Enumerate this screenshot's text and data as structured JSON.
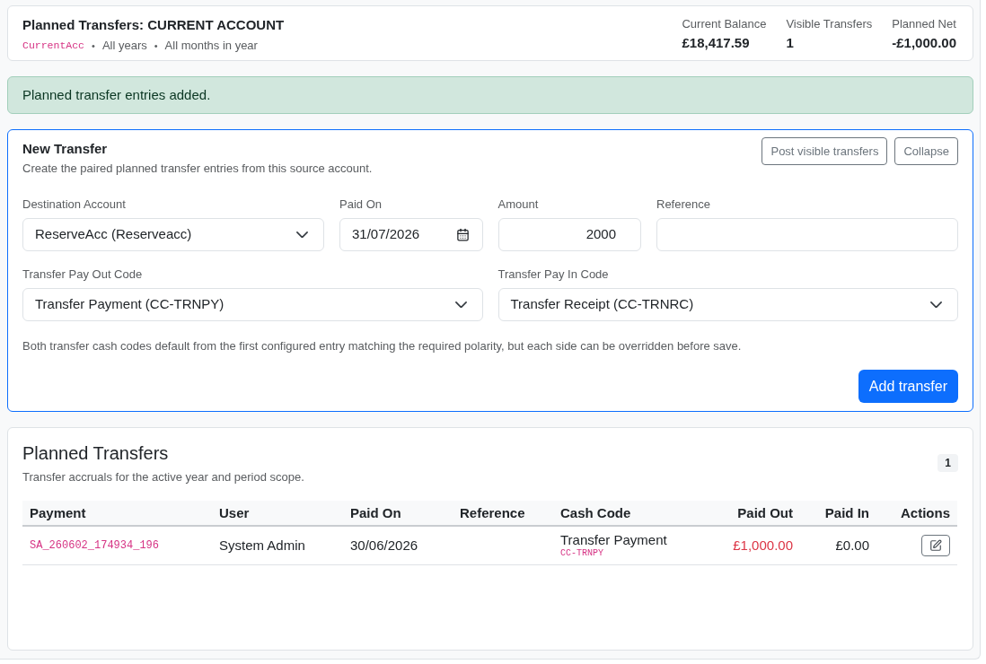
{
  "header": {
    "title": "Planned Transfers: CURRENT ACCOUNT",
    "subtitle": [
      {
        "kind": "code",
        "text": "CurrentAcc"
      },
      {
        "kind": "separator",
        "text": "•"
      },
      {
        "kind": "text",
        "text": "All years"
      },
      {
        "kind": "separator",
        "text": "•"
      },
      {
        "kind": "text",
        "text": "All months in year"
      }
    ],
    "stats": [
      {
        "label": "Current Balance",
        "value": "£18,417.59"
      },
      {
        "label": "Visible Transfers",
        "value": "1"
      },
      {
        "label": "Planned Net",
        "value": "-£1,000.00"
      }
    ]
  },
  "alert": {
    "kind": "success",
    "message": "Planned transfer entries added."
  },
  "new_transfer": {
    "title": "New Transfer",
    "description": "Create the paired planned transfer entries from this source account.",
    "buttons": [
      {
        "kind": "outline",
        "label": "Post visible transfers"
      },
      {
        "kind": "outline",
        "label": "Collapse"
      }
    ],
    "fields": [
      {
        "kind": "select",
        "label": "Destination Account",
        "value": "ReserveAcc (Reserveacc)"
      },
      {
        "kind": "date",
        "label": "Paid On",
        "value": "31/07/2026"
      },
      {
        "kind": "number",
        "label": "Amount",
        "value": "2000"
      },
      {
        "kind": "text",
        "label": "Reference"
      },
      {
        "kind": "select",
        "label": "Transfer Pay Out Code",
        "value": "Transfer Payment (CC-TRNPY)"
      },
      {
        "kind": "select",
        "label": "Transfer Pay In Code",
        "value": "Transfer Receipt (CC-TRNRC)"
      }
    ],
    "help_text": "Both transfer cash codes default from the first configured entry matching the required polarity, but each side can be overridden before save.",
    "submit": "Add transfer"
  },
  "planned_transfers": {
    "title": "Planned Transfers",
    "description": "Transfer accruals for the active year and period scope.",
    "count": "1",
    "table": {
      "columns": [
        "Payment",
        "User",
        "Paid On",
        "Reference",
        "Cash Code",
        "Paid Out",
        "Paid In",
        "Actions"
      ],
      "rows": [
        {
          "payment": "SA_260602_174934_196",
          "user": "System Admin",
          "paid_on": "30/06/2026",
          "cash_code": {
            "name": "Transfer Payment",
            "code": "CC-TRNPY"
          },
          "paid_out": "£1,000.00",
          "paid_in": "£0.00",
          "actions": [
            {
              "kind": "edit"
            }
          ]
        }
      ]
    }
  }
}
